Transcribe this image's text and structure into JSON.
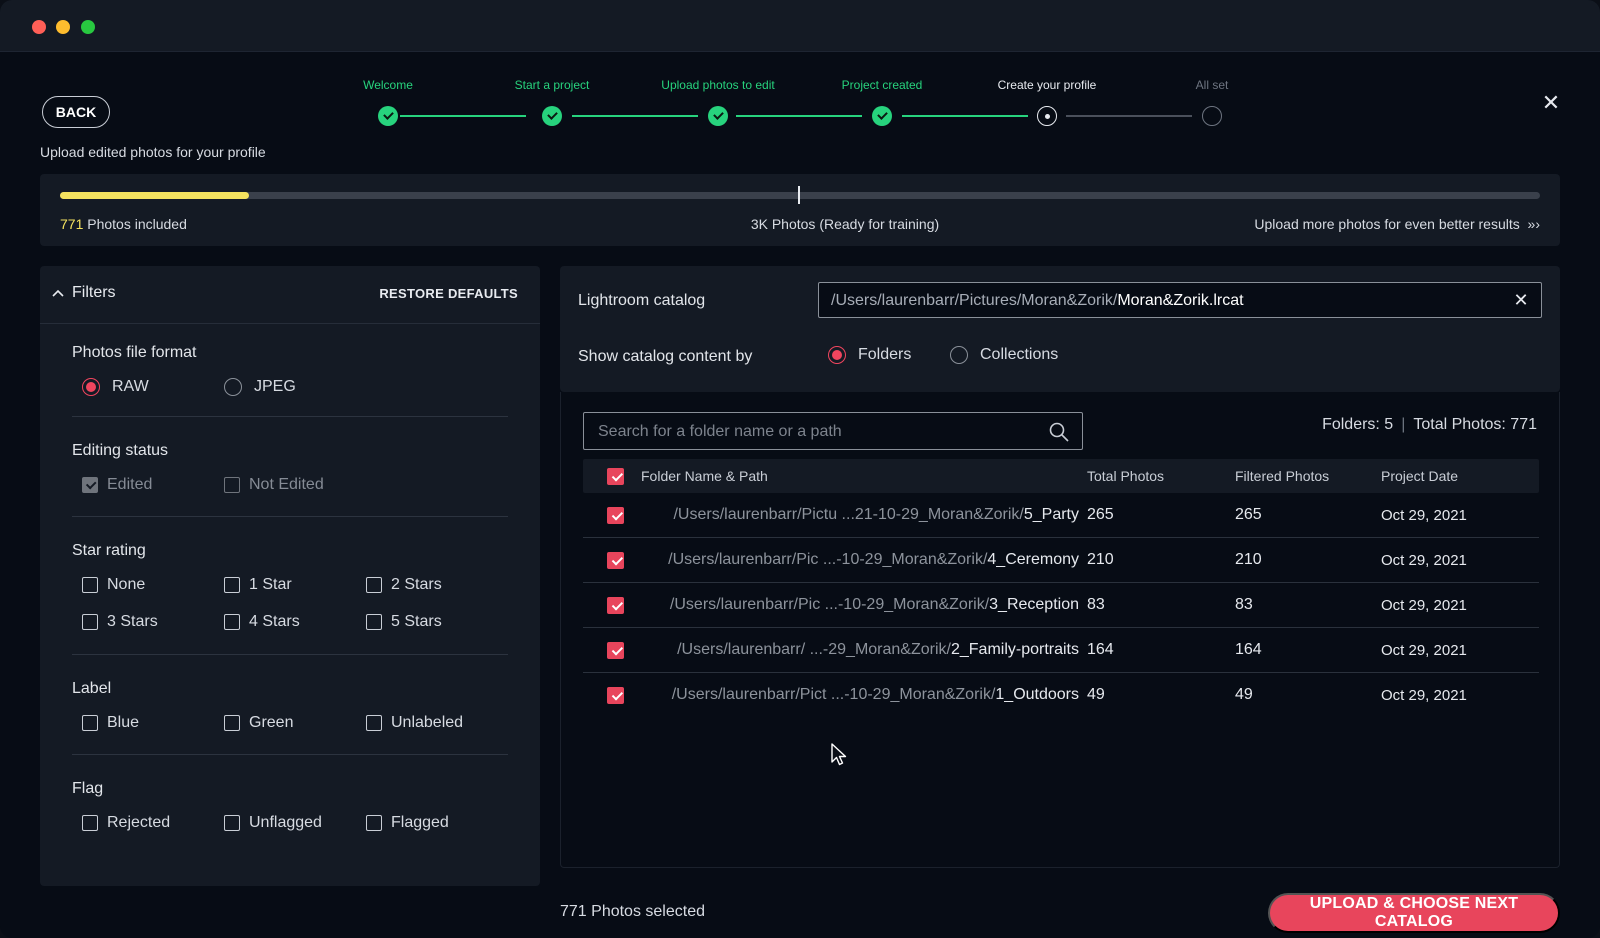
{
  "window": {
    "traffic_lights": [
      "close",
      "minimize",
      "maximize"
    ]
  },
  "header": {
    "back_label": "BACK",
    "subtitle": "Upload edited photos for your profile"
  },
  "steps": [
    {
      "label": "Welcome",
      "state": "done"
    },
    {
      "label": "Start a project",
      "state": "done"
    },
    {
      "label": "Upload photos to edit",
      "state": "done"
    },
    {
      "label": "Project created",
      "state": "done"
    },
    {
      "label": "Create your profile",
      "state": "current"
    },
    {
      "label": "All set",
      "state": "pending"
    }
  ],
  "progress": {
    "included_count": "771",
    "included_text": " Photos included",
    "target_text": "3K Photos (Ready for training)",
    "more_text": "Upload more photos for even better results",
    "more_icon": "»›",
    "fill_fraction": 0.128,
    "fill_color": "#f4e25f"
  },
  "filters": {
    "title": "Filters",
    "restore_label": "RESTORE DEFAULTS",
    "file_format": {
      "title": "Photos file format",
      "options": [
        "RAW",
        "JPEG"
      ],
      "selected": "RAW"
    },
    "editing_status": {
      "title": "Editing status",
      "options": [
        "Edited",
        "Not Edited"
      ]
    },
    "star_rating": {
      "title": "Star rating",
      "options": [
        "None",
        "1 Star",
        "2 Stars",
        "3 Stars",
        "4 Stars",
        "5 Stars"
      ]
    },
    "label": {
      "title": "Label",
      "options": [
        "Blue",
        "Green",
        "Unlabeled"
      ]
    },
    "flag": {
      "title": "Flag",
      "options": [
        "Rejected",
        "Unflagged",
        "Flagged"
      ]
    }
  },
  "catalog": {
    "label": "Lightroom catalog",
    "path_dim": "/Users/laurenbarr/Pictures/Moran&Zorik/",
    "path_file": "Moran&Zorik.lrcat",
    "show_label": "Show catalog content by",
    "modes": [
      "Folders",
      "Collections"
    ],
    "selected_mode": "Folders"
  },
  "folders": {
    "search_placeholder": "Search for a folder name or a path",
    "folders_count_text": "Folders: 5",
    "total_photos_text": "Total Photos: 771",
    "columns": [
      "Folder Name & Path",
      "Total Photos",
      "Filtered Photos",
      "Project Date"
    ],
    "rows": [
      {
        "path_dim": "/Users/laurenbarr/Pictu ...21-10-29_Moran&Zorik/",
        "name": "5_Party",
        "total": "265",
        "filtered": "265",
        "date": "Oct 29, 2021"
      },
      {
        "path_dim": "/Users/laurenbarr/Pic ...-10-29_Moran&Zorik/",
        "name": "4_Ceremony",
        "total": "210",
        "filtered": "210",
        "date": "Oct 29, 2021"
      },
      {
        "path_dim": "/Users/laurenbarr/Pic ...-10-29_Moran&Zorik/",
        "name": "3_Reception",
        "total": "83",
        "filtered": "83",
        "date": "Oct 29, 2021"
      },
      {
        "path_dim": "/Users/laurenbarr/ ...-29_Moran&Zorik/",
        "name": "2_Family-portraits",
        "total": "164",
        "filtered": "164",
        "date": "Oct 29, 2021"
      },
      {
        "path_dim": "/Users/laurenbarr/Pict ...-10-29_Moran&Zorik/",
        "name": "1_Outdoors",
        "total": "49",
        "filtered": "49",
        "date": "Oct 29, 2021"
      }
    ]
  },
  "footer": {
    "selected_text": "771 Photos selected",
    "upload_label": "UPLOAD & CHOOSE NEXT CATALOG"
  },
  "colors": {
    "accent_red": "#e8455c",
    "done_green": "#27d37d",
    "panel": "#141a24",
    "background": "#070c15"
  }
}
